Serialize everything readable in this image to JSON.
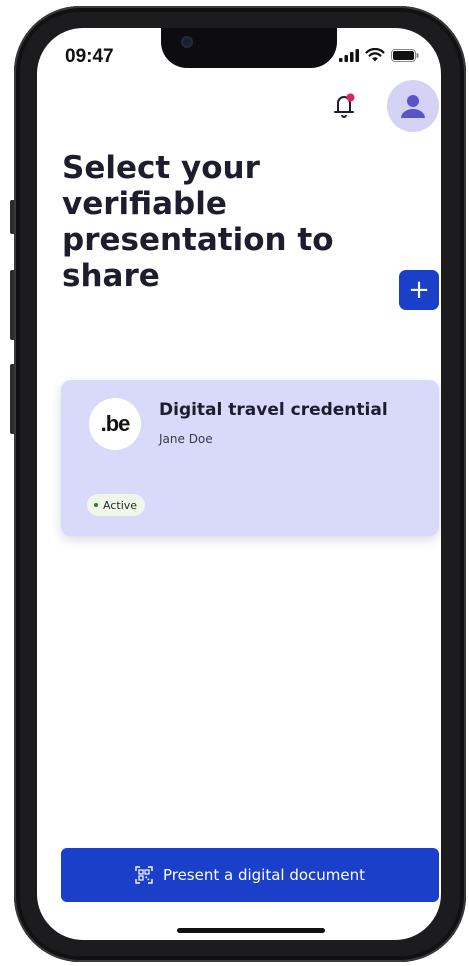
{
  "status_bar": {
    "time": "09:47"
  },
  "header": {
    "title": "Select your verifiable presentation to share",
    "notification_icon": "bell-icon",
    "profile_icon": "user-icon",
    "add_label": "+"
  },
  "credentials": [
    {
      "logo_text": ".be",
      "title": "Digital travel credential",
      "holder": "Jane Doe",
      "status": "Active"
    }
  ],
  "footer": {
    "present_label": "Present a digital document",
    "present_icon": "qr-scan-icon"
  },
  "colors": {
    "primary": "#1a3fc9",
    "card_bg": "#d9d9fa",
    "avatar_bg": "#d5d3f5",
    "avatar_icon": "#5b54c9",
    "notification_dot": "#e0245e",
    "active_badge_bg": "#eef7ea",
    "active_dot": "#2e7d32"
  }
}
